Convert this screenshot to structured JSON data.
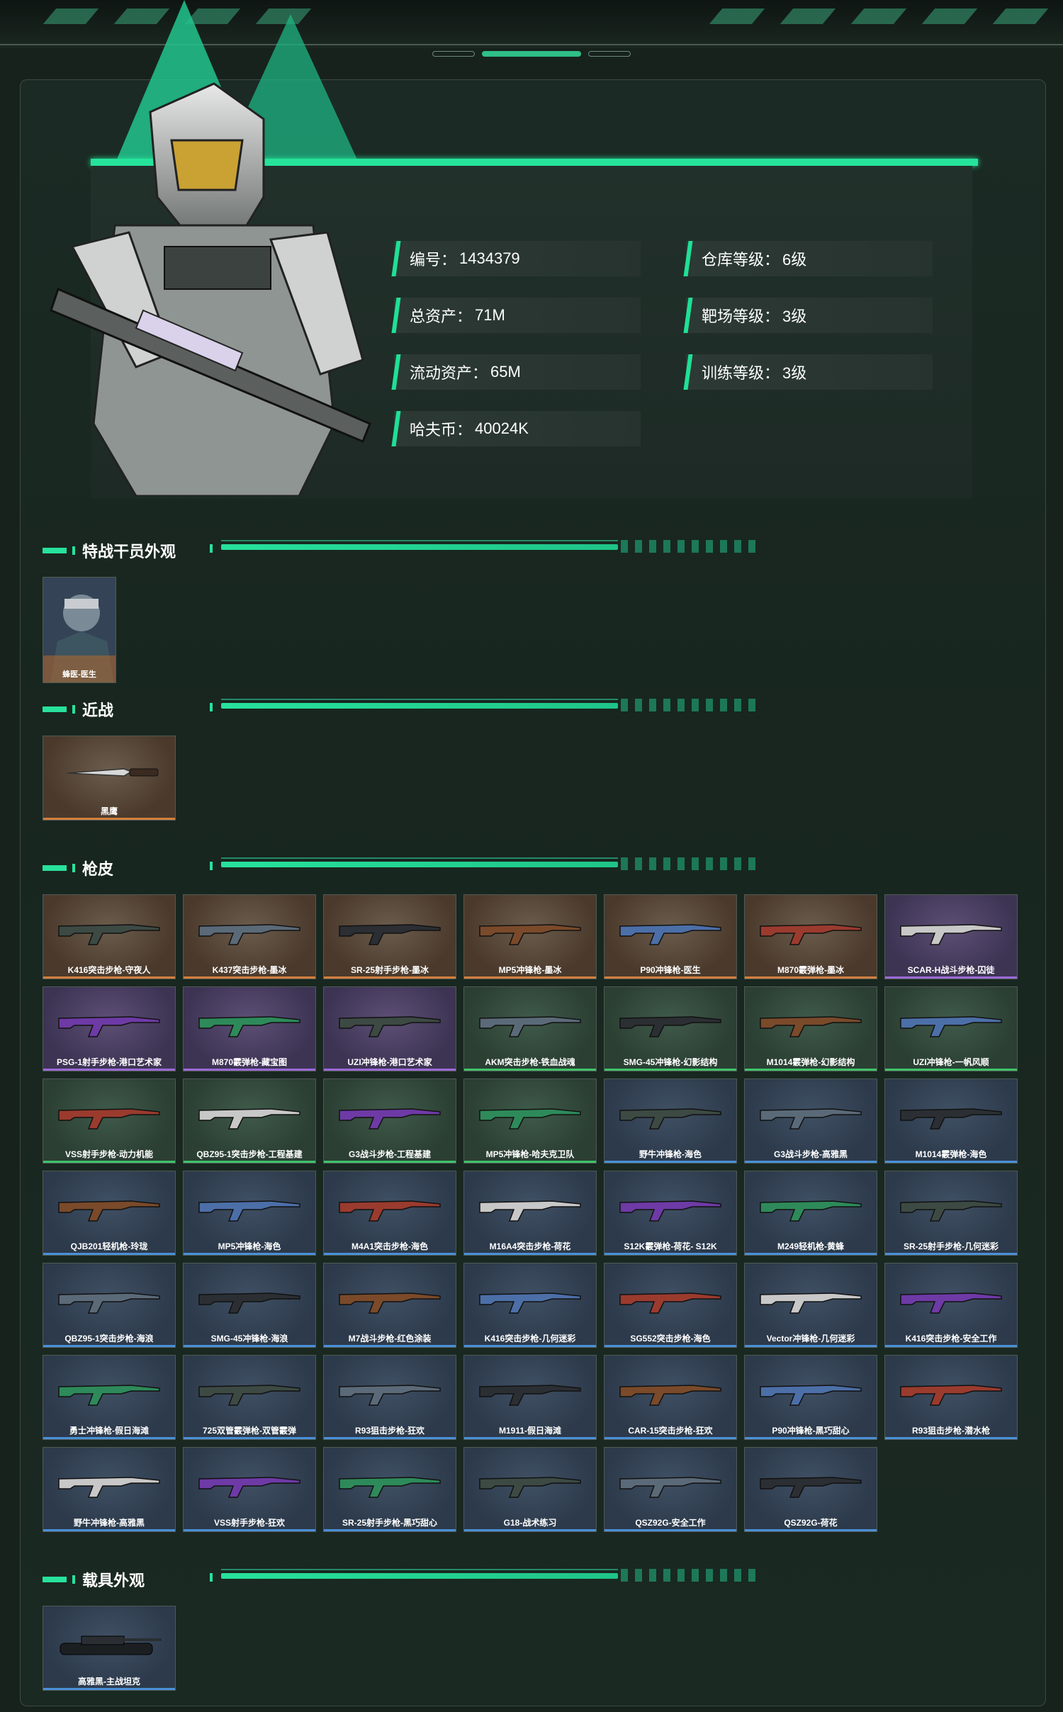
{
  "profile": {
    "id_label": "编号：",
    "id_value": "1434379",
    "assets_label": "总资产：",
    "assets_value": "71M",
    "liquid_label": "流动资产：",
    "liquid_value": "65M",
    "havcoin_label": "哈夫币：",
    "havcoin_value": "40024K",
    "warehouse_label": "仓库等级：",
    "warehouse_value": "6级",
    "range_label": "靶场等级：",
    "range_value": "3级",
    "training_label": "训练等级：",
    "training_value": "3级"
  },
  "sections": {
    "agent_skins": "特战干员外观",
    "melee": "近战",
    "gun_skins": "枪皮",
    "vehicle_skins": "载具外观"
  },
  "agent_skins": [
    {
      "name": "蜂医-医生"
    }
  ],
  "melee": [
    {
      "name": "黑鹰",
      "rarity": "orange"
    }
  ],
  "gun_skins": [
    {
      "name": "K416突击步枪-守夜人",
      "rarity": "orange"
    },
    {
      "name": "K437突击步枪-墨冰",
      "rarity": "orange"
    },
    {
      "name": "SR-25射手步枪-墨冰",
      "rarity": "orange"
    },
    {
      "name": "MP5冲锋枪-墨冰",
      "rarity": "orange"
    },
    {
      "name": "P90冲锋枪-医生",
      "rarity": "orange"
    },
    {
      "name": "M870霰弹枪-墨冰",
      "rarity": "orange"
    },
    {
      "name": "SCAR-H战斗步枪-囚徒",
      "rarity": "purple"
    },
    {
      "name": "PSG-1射手步枪-港口艺术家",
      "rarity": "purple"
    },
    {
      "name": "M870霰弹枪-藏宝图",
      "rarity": "purple"
    },
    {
      "name": "UZI冲锋枪-港口艺术家",
      "rarity": "purple"
    },
    {
      "name": "AKM突击步枪-铁血战魂",
      "rarity": "green"
    },
    {
      "name": "SMG-45冲锋枪-幻影结构",
      "rarity": "green"
    },
    {
      "name": "M1014霰弹枪-幻影结构",
      "rarity": "green"
    },
    {
      "name": "UZI冲锋枪-一帆风顺",
      "rarity": "green"
    },
    {
      "name": "VSS射手步枪-动力机能",
      "rarity": "green"
    },
    {
      "name": "QBZ95-1突击步枪-工程基建",
      "rarity": "green"
    },
    {
      "name": "G3战斗步枪-工程基建",
      "rarity": "green"
    },
    {
      "name": "MP5冲锋枪-哈夫克卫队",
      "rarity": "green"
    },
    {
      "name": "野牛冲锋枪-海色",
      "rarity": "blue"
    },
    {
      "name": "G3战斗步枪-高雅黑",
      "rarity": "blue"
    },
    {
      "name": "M1014霰弹枪-海色",
      "rarity": "blue"
    },
    {
      "name": "QJB201轻机枪-玲珑",
      "rarity": "blue"
    },
    {
      "name": "MP5冲锋枪-海色",
      "rarity": "blue"
    },
    {
      "name": "M4A1突击步枪-海色",
      "rarity": "blue"
    },
    {
      "name": "M16A4突击步枪-荷花",
      "rarity": "blue"
    },
    {
      "name": "S12K霰弹枪-荷花- S12K",
      "rarity": "blue"
    },
    {
      "name": "M249轻机枪-黄蜂",
      "rarity": "blue"
    },
    {
      "name": "SR-25射手步枪-几何迷彩",
      "rarity": "blue"
    },
    {
      "name": "QBZ95-1突击步枪-海浪",
      "rarity": "blue"
    },
    {
      "name": "SMG-45冲锋枪-海浪",
      "rarity": "blue"
    },
    {
      "name": "M7战斗步枪-红色涂装",
      "rarity": "blue"
    },
    {
      "name": "K416突击步枪-几何迷彩",
      "rarity": "blue"
    },
    {
      "name": "SG552突击步枪-海色",
      "rarity": "blue"
    },
    {
      "name": "Vector冲锋枪-几何迷彩",
      "rarity": "blue"
    },
    {
      "name": "K416突击步枪-安全工作",
      "rarity": "blue"
    },
    {
      "name": "勇士冲锋枪-假日海滩",
      "rarity": "blue"
    },
    {
      "name": "725双管霰弹枪-双管霰弹",
      "rarity": "blue"
    },
    {
      "name": "R93狙击步枪-狂欢",
      "rarity": "blue"
    },
    {
      "name": "M1911-假日海滩",
      "rarity": "blue"
    },
    {
      "name": "CAR-15突击步枪-狂欢",
      "rarity": "blue"
    },
    {
      "name": "P90冲锋枪-黑巧甜心",
      "rarity": "blue"
    },
    {
      "name": "R93狙击步枪-潜水枪",
      "rarity": "blue"
    },
    {
      "name": "野牛冲锋枪-高雅黑",
      "rarity": "blue"
    },
    {
      "name": "VSS射手步枪-狂欢",
      "rarity": "blue"
    },
    {
      "name": "SR-25射手步枪-黑巧甜心",
      "rarity": "blue"
    },
    {
      "name": "G18-战术练习",
      "rarity": "blue"
    },
    {
      "name": "QSZ92G-安全工作",
      "rarity": "blue"
    },
    {
      "name": "QSZ92G-荷花",
      "rarity": "blue"
    }
  ],
  "vehicle_skins": [
    {
      "name": "高雅黑-主战坦克",
      "rarity": "blue"
    }
  ],
  "colors": {
    "accent": "#27e29c",
    "orange": "#d3803d",
    "purple": "#9b6ad6",
    "green": "#3fc46a",
    "blue": "#4a90d9"
  }
}
